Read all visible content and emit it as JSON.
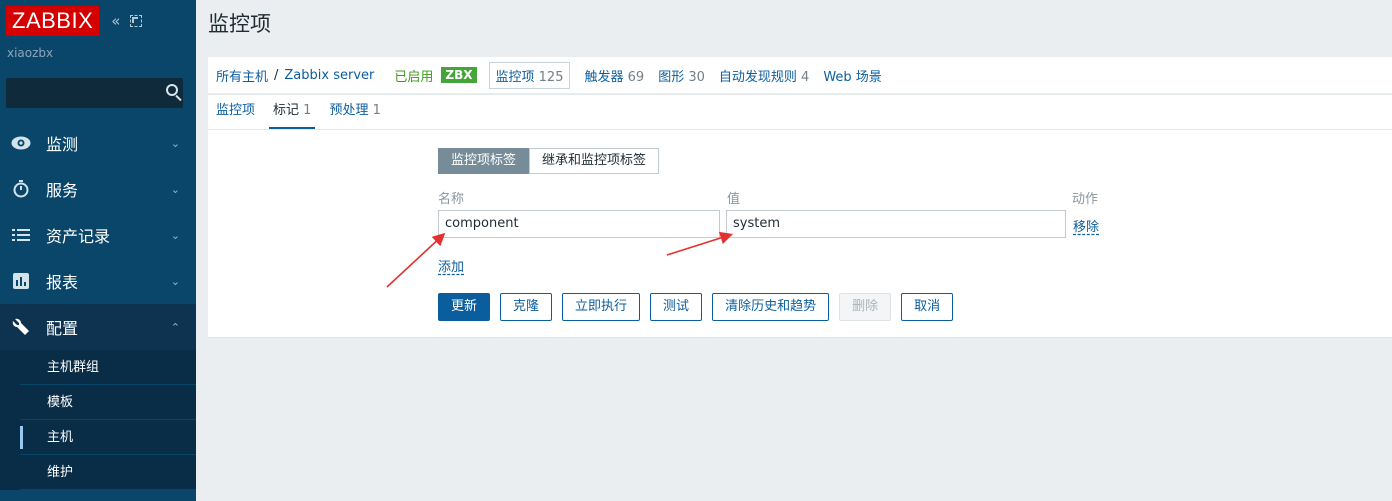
{
  "app": {
    "logo": "ZABBIX",
    "server_name": "xiaozbx"
  },
  "sidebar": {
    "search_placeholder": "",
    "menu": [
      {
        "label": "监测",
        "icon": "eye-icon"
      },
      {
        "label": "服务",
        "icon": "stopwatch-icon"
      },
      {
        "label": "资产记录",
        "icon": "list-icon"
      },
      {
        "label": "报表",
        "icon": "bar-chart-icon"
      },
      {
        "label": "配置",
        "icon": "wrench-icon"
      }
    ],
    "submenu": [
      "主机群组",
      "模板",
      "主机",
      "维护"
    ]
  },
  "page": {
    "title": "监控项"
  },
  "breadcrumb": {
    "all_hosts": "所有主机",
    "sep": "/",
    "host": "Zabbix server",
    "status": "已启用",
    "badge": "ZBX",
    "tabs": [
      {
        "label": "监控项",
        "count": "125"
      },
      {
        "label": "触发器",
        "count": "69"
      },
      {
        "label": "图形",
        "count": "30"
      },
      {
        "label": "自动发现规则",
        "count": "4"
      },
      {
        "label": "Web 场景",
        "count": ""
      }
    ]
  },
  "tabs": [
    {
      "label": "监控项",
      "count": ""
    },
    {
      "label": "标记",
      "count": "1"
    },
    {
      "label": "预处理",
      "count": "1"
    }
  ],
  "tags_form": {
    "toggle_own": "监控项标签",
    "toggle_inherited": "继承和监控项标签",
    "col_name": "名称",
    "col_value": "值",
    "col_action": "动作",
    "tag_name": "component",
    "tag_value": "system",
    "remove": "移除",
    "add": "添加"
  },
  "buttons": {
    "update": "更新",
    "clone": "克隆",
    "execute_now": "立即执行",
    "test": "测试",
    "clear_history": "清除历史和趋势",
    "delete": "删除",
    "cancel": "取消"
  },
  "colors": {
    "sidebar": "#0a466a",
    "accent": "#0b5e9e",
    "logo": "#d40000",
    "enabled": "#3f9b1f",
    "annotation": "#e53030"
  }
}
